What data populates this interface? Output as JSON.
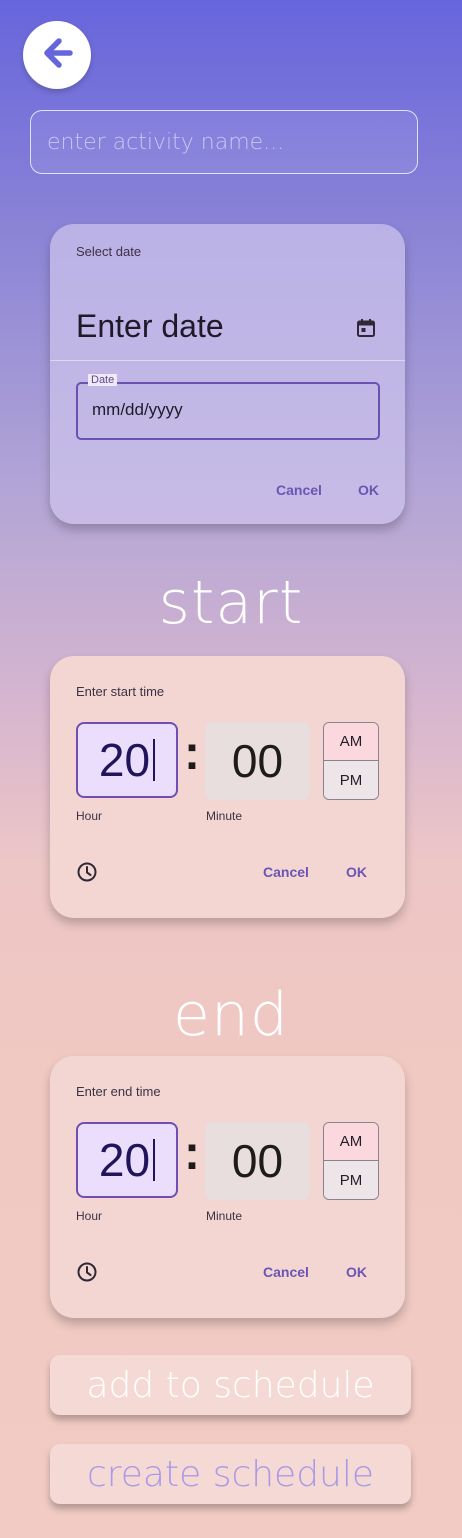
{
  "nav": {
    "back_icon": "arrow-left-icon"
  },
  "activity": {
    "placeholder": "enter activity name...",
    "value": ""
  },
  "date_picker": {
    "header": "Select date",
    "heading": "Enter date",
    "calendar_icon": "calendar-icon",
    "field_label": "Date",
    "field_placeholder": "mm/dd/yyyy",
    "cancel_label": "Cancel",
    "ok_label": "OK"
  },
  "start": {
    "section_title": "start",
    "header": "Enter start time",
    "hour": "20",
    "minute": "00",
    "colon": ":",
    "am_label": "AM",
    "pm_label": "PM",
    "selected_period": "AM",
    "hour_label": "Hour",
    "minute_label": "Minute",
    "clock_icon": "clock-icon",
    "cancel_label": "Cancel",
    "ok_label": "OK"
  },
  "end": {
    "section_title": "end",
    "header": "Enter end time",
    "hour": "20",
    "minute": "00",
    "colon": ":",
    "am_label": "AM",
    "pm_label": "PM",
    "selected_period": "AM",
    "hour_label": "Hour",
    "minute_label": "Minute",
    "clock_icon": "clock-icon",
    "cancel_label": "Cancel",
    "ok_label": "OK"
  },
  "actions": {
    "add_label": "add to schedule",
    "create_label": "create schedule"
  },
  "colors": {
    "gradient_top": "#6765dc",
    "gradient_bottom": "#f1cbc4",
    "accent": "#6a55b5",
    "selected_am": "#fbd8dd",
    "create_text": "#a99ae8"
  }
}
